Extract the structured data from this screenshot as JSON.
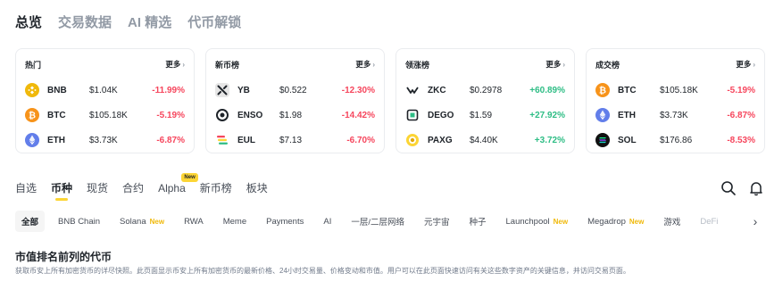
{
  "top_tabs": [
    {
      "label": "总览",
      "active": true
    },
    {
      "label": "交易数据",
      "active": false
    },
    {
      "label": "AI 精选",
      "active": false
    },
    {
      "label": "代币解锁",
      "active": false
    }
  ],
  "cards": [
    {
      "title": "热门",
      "more": "更多",
      "rows": [
        {
          "symbol": "BNB",
          "price": "$1.04K",
          "change": "-11.99%",
          "dir": "neg",
          "icon": "bnb-icon"
        },
        {
          "symbol": "BTC",
          "price": "$105.18K",
          "change": "-5.19%",
          "dir": "neg",
          "icon": "btc-icon"
        },
        {
          "symbol": "ETH",
          "price": "$3.73K",
          "change": "-6.87%",
          "dir": "neg",
          "icon": "eth-icon"
        }
      ]
    },
    {
      "title": "新币榜",
      "more": "更多",
      "rows": [
        {
          "symbol": "YB",
          "price": "$0.522",
          "change": "-12.30%",
          "dir": "neg",
          "icon": "yb-icon"
        },
        {
          "symbol": "ENSO",
          "price": "$1.98",
          "change": "-14.42%",
          "dir": "neg",
          "icon": "enso-icon"
        },
        {
          "symbol": "EUL",
          "price": "$7.13",
          "change": "-6.70%",
          "dir": "neg",
          "icon": "eul-icon"
        }
      ]
    },
    {
      "title": "领涨榜",
      "more": "更多",
      "rows": [
        {
          "symbol": "ZKC",
          "price": "$0.2978",
          "change": "+60.89%",
          "dir": "pos",
          "icon": "zkc-icon"
        },
        {
          "symbol": "DEGO",
          "price": "$1.59",
          "change": "+27.92%",
          "dir": "pos",
          "icon": "dego-icon"
        },
        {
          "symbol": "PAXG",
          "price": "$4.40K",
          "change": "+3.72%",
          "dir": "pos",
          "icon": "paxg-icon"
        }
      ]
    },
    {
      "title": "成交榜",
      "more": "更多",
      "rows": [
        {
          "symbol": "BTC",
          "price": "$105.18K",
          "change": "-5.19%",
          "dir": "neg",
          "icon": "btc-icon"
        },
        {
          "symbol": "ETH",
          "price": "$3.73K",
          "change": "-6.87%",
          "dir": "neg",
          "icon": "eth-icon"
        },
        {
          "symbol": "SOL",
          "price": "$176.86",
          "change": "-8.53%",
          "dir": "neg",
          "icon": "sol-icon"
        }
      ]
    }
  ],
  "section_tabs": [
    {
      "label": "自选",
      "active": false
    },
    {
      "label": "币种",
      "active": true
    },
    {
      "label": "现货",
      "active": false
    },
    {
      "label": "合约",
      "active": false
    },
    {
      "label": "Alpha",
      "active": false,
      "badge": "New"
    },
    {
      "label": "新币榜",
      "active": false
    },
    {
      "label": "板块",
      "active": false
    }
  ],
  "chips": [
    {
      "label": "全部",
      "active": true
    },
    {
      "label": "BNB Chain"
    },
    {
      "label": "Solana",
      "new": "New"
    },
    {
      "label": "RWA"
    },
    {
      "label": "Meme"
    },
    {
      "label": "Payments"
    },
    {
      "label": "AI"
    },
    {
      "label": "一层/二层网络"
    },
    {
      "label": "元宇宙"
    },
    {
      "label": "种子"
    },
    {
      "label": "Launchpool",
      "new": "New"
    },
    {
      "label": "Megadrop",
      "new": "New"
    },
    {
      "label": "游戏"
    },
    {
      "label": "DeFi",
      "fade": true
    }
  ],
  "section": {
    "title": "市值排名前列的代币",
    "description": "获取币安上所有加密货币的详尽快照。此页面显示币安上所有加密货币的最新价格、24小时交易量、价格变动和市值。用户可以在此页面快速访问有关这些数字资产的关键信息，并访问交易页面。"
  },
  "colors": {
    "up": "#2ebd85",
    "down": "#f6465d",
    "accent": "#fcd535"
  }
}
